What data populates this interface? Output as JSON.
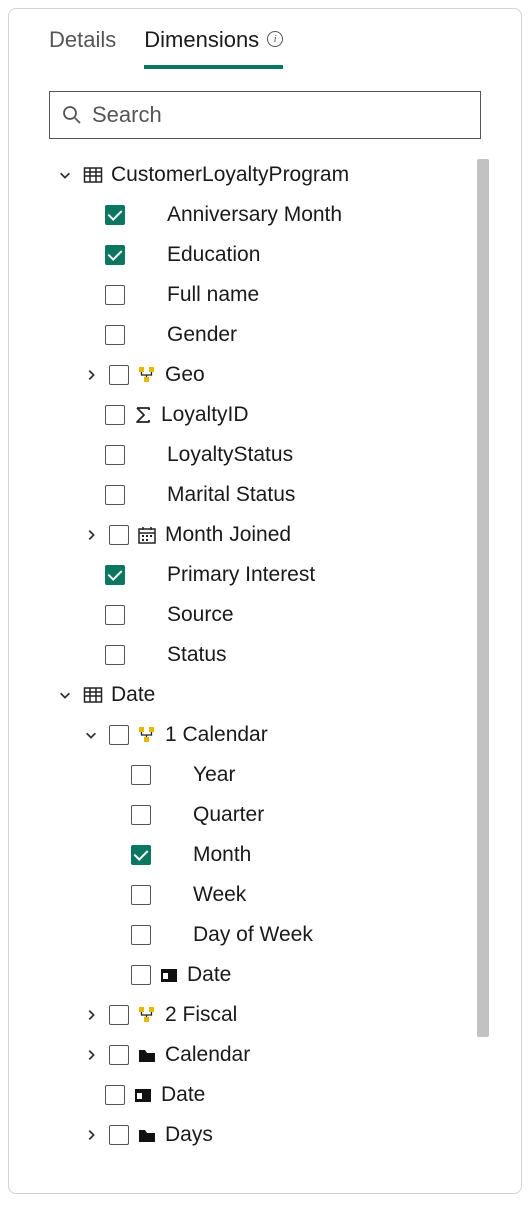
{
  "tabs": {
    "details": "Details",
    "dimensions": "Dimensions"
  },
  "search": {
    "placeholder": "Search"
  },
  "tree": [
    {
      "label": "CustomerLoyaltyProgram",
      "level": 0,
      "chevron": "down",
      "icon": "table",
      "checkbox": null
    },
    {
      "label": "Anniversary Month",
      "level": 1,
      "chevron": null,
      "icon": null,
      "checkbox": true
    },
    {
      "label": "Education",
      "level": 1,
      "chevron": null,
      "icon": null,
      "checkbox": true
    },
    {
      "label": "Full name",
      "level": 1,
      "chevron": null,
      "icon": null,
      "checkbox": false
    },
    {
      "label": "Gender",
      "level": 1,
      "chevron": null,
      "icon": null,
      "checkbox": false
    },
    {
      "label": "Geo",
      "level": 1,
      "chevron": "right",
      "icon": "hierarchy",
      "checkbox": false
    },
    {
      "label": "LoyaltyID",
      "level": 1,
      "chevron": null,
      "icon": "sigma",
      "checkbox": false
    },
    {
      "label": "LoyaltyStatus",
      "level": 1,
      "chevron": null,
      "icon": null,
      "checkbox": false
    },
    {
      "label": "Marital Status",
      "level": 1,
      "chevron": null,
      "icon": null,
      "checkbox": false
    },
    {
      "label": "Month Joined",
      "level": 1,
      "chevron": "right",
      "icon": "calendar",
      "checkbox": false
    },
    {
      "label": "Primary Interest",
      "level": 1,
      "chevron": null,
      "icon": null,
      "checkbox": true
    },
    {
      "label": "Source",
      "level": 1,
      "chevron": null,
      "icon": null,
      "checkbox": false
    },
    {
      "label": "Status",
      "level": 1,
      "chevron": null,
      "icon": null,
      "checkbox": false
    },
    {
      "label": "Date",
      "level": 0,
      "chevron": "down",
      "icon": "table",
      "checkbox": null
    },
    {
      "label": "1 Calendar",
      "level": 1,
      "chevron": "down",
      "icon": "hierarchy",
      "checkbox": false
    },
    {
      "label": "Year",
      "level": 2,
      "chevron": null,
      "icon": null,
      "checkbox": false
    },
    {
      "label": "Quarter",
      "level": 2,
      "chevron": null,
      "icon": null,
      "checkbox": false
    },
    {
      "label": "Month",
      "level": 2,
      "chevron": null,
      "icon": null,
      "checkbox": true
    },
    {
      "label": "Week",
      "level": 2,
      "chevron": null,
      "icon": null,
      "checkbox": false
    },
    {
      "label": "Day of Week",
      "level": 2,
      "chevron": null,
      "icon": null,
      "checkbox": false
    },
    {
      "label": "Date",
      "level": 2,
      "chevron": null,
      "icon": "date",
      "checkbox": false,
      "tight": true
    },
    {
      "label": "2 Fiscal",
      "level": 1,
      "chevron": "right",
      "icon": "hierarchy",
      "checkbox": false
    },
    {
      "label": "Calendar",
      "level": 1,
      "chevron": "right",
      "icon": "folder",
      "checkbox": false
    },
    {
      "label": "Date",
      "level": 1,
      "chevron": null,
      "icon": "date",
      "checkbox": false
    },
    {
      "label": "Days",
      "level": 1,
      "chevron": "right",
      "icon": "folder",
      "checkbox": false
    }
  ]
}
